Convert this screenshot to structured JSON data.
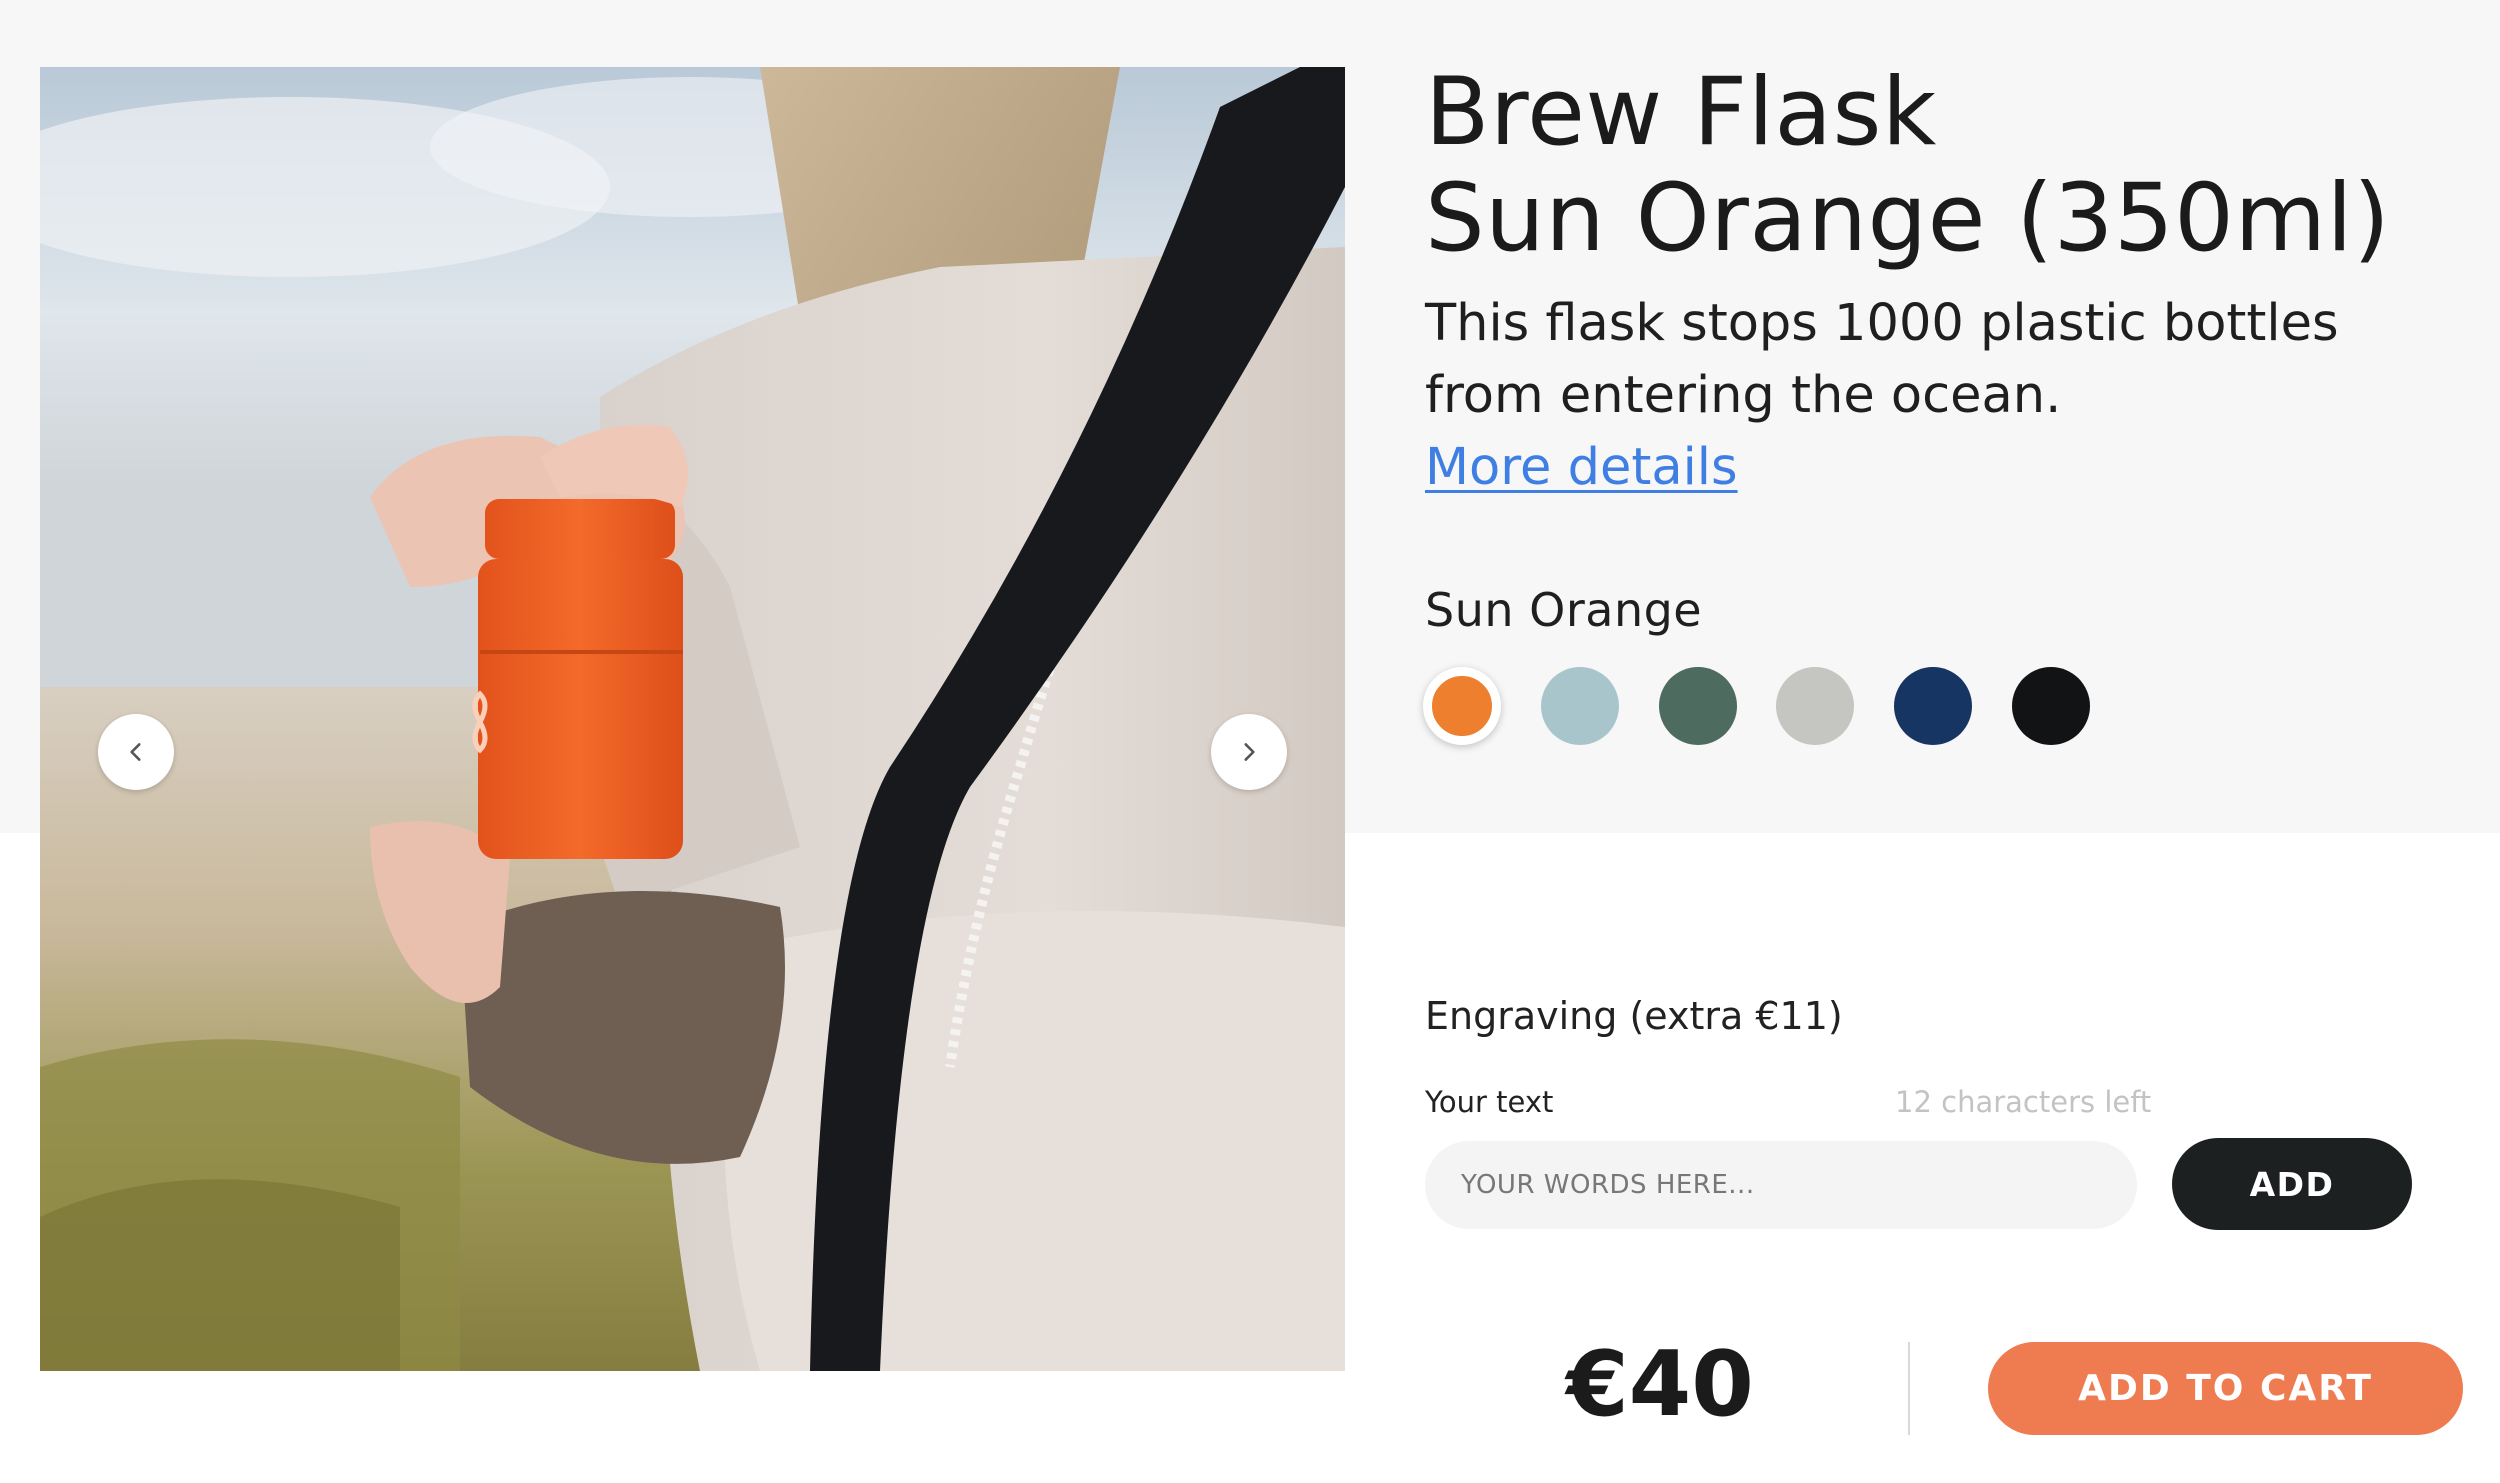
{
  "product": {
    "title_line1": "Brew Flask",
    "title_line2": "Sun Orange (350ml)",
    "tagline": "This flask stops 1000 plastic bottles from entering the ocean.",
    "more_details_label": "More details",
    "photo_alt": "Woman holding an orange flask on a beach"
  },
  "gallery": {
    "prev_icon": "chevron-left-icon",
    "next_icon": "chevron-right-icon"
  },
  "color_selector": {
    "selected_name": "Sun Orange",
    "swatches": [
      {
        "name": "Sun Orange",
        "color": "#ee7f2e",
        "selected": true
      },
      {
        "name": "light-blue",
        "color": "#a9c5cc",
        "selected": false
      },
      {
        "name": "forest-green",
        "color": "#4d6b5e",
        "selected": false
      },
      {
        "name": "light-grey",
        "color": "#c5c5c2",
        "selected": false
      },
      {
        "name": "navy",
        "color": "#163563",
        "selected": false
      },
      {
        "name": "black",
        "color": "#121314",
        "selected": false
      }
    ]
  },
  "engraving": {
    "heading": "Engraving (extra €11)",
    "label": "Your text",
    "counter": "12 characters left",
    "input_value": "",
    "placeholder": "YOUR WORDS HERE...",
    "add_button_label": "ADD"
  },
  "purchase": {
    "price": "€40",
    "add_to_cart_label": "ADD TO CART"
  },
  "colors": {
    "accent_orange": "#ef7b50",
    "link_blue": "#3f7fe3",
    "dark_button": "#1d2021"
  }
}
